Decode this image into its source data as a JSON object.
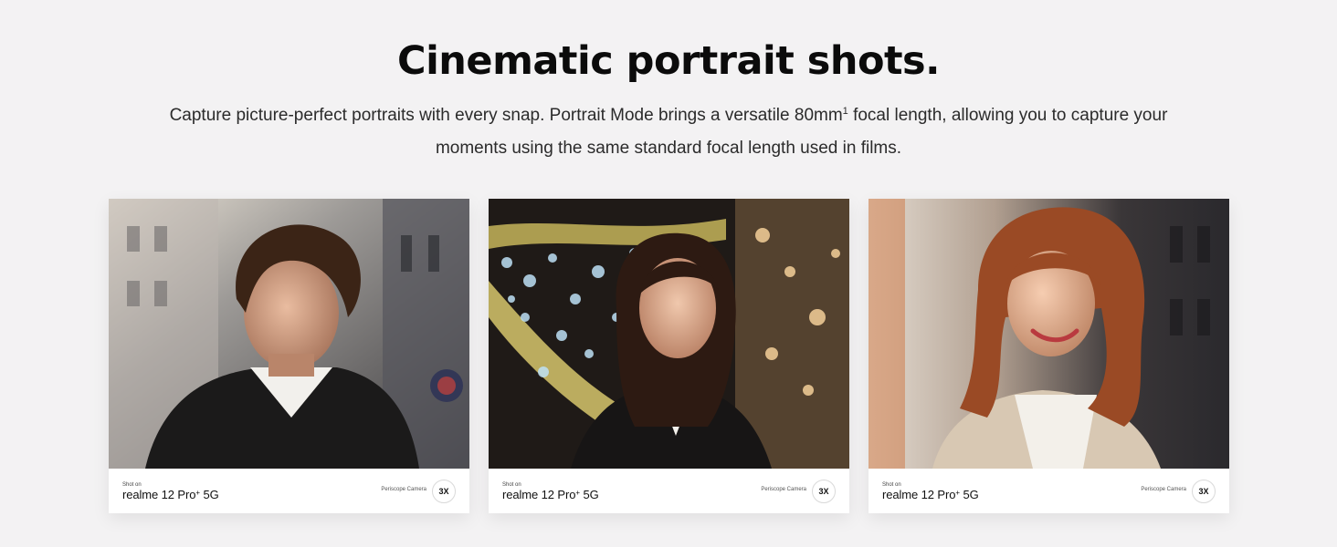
{
  "section": {
    "title": "Cinematic portrait shots.",
    "description_line1_a": "Capture picture-perfect portraits with every snap. Portrait Mode brings a versatile 80mm",
    "description_sup": "1",
    "description_line1_b": " focal length, allowing you to capture your",
    "description_line2": "moments using the same standard focal length used in films."
  },
  "cards": [
    {
      "shot_on": "Shot on",
      "device": "realme 12 Pro",
      "device_sup": "+",
      "device_suffix": " 5G",
      "camera": "Periscope Camera",
      "zoom": "3X",
      "photo_icon": "portrait-photo-man-city-icon"
    },
    {
      "shot_on": "Shot on",
      "device": "realme 12 Pro",
      "device_sup": "+",
      "device_suffix": " 5G",
      "camera": "Periscope Camera",
      "zoom": "3X",
      "photo_icon": "portrait-photo-woman-bokeh-icon"
    },
    {
      "shot_on": "Shot on",
      "device": "realme 12 Pro",
      "device_sup": "+",
      "device_suffix": " 5G",
      "camera": "Periscope Camera",
      "zoom": "3X",
      "photo_icon": "portrait-photo-woman-sunlight-icon"
    }
  ],
  "colors": {
    "background": "#f3f2f3",
    "title": "#0b0b0b",
    "text": "#2b2b2b",
    "card": "#ffffff"
  }
}
